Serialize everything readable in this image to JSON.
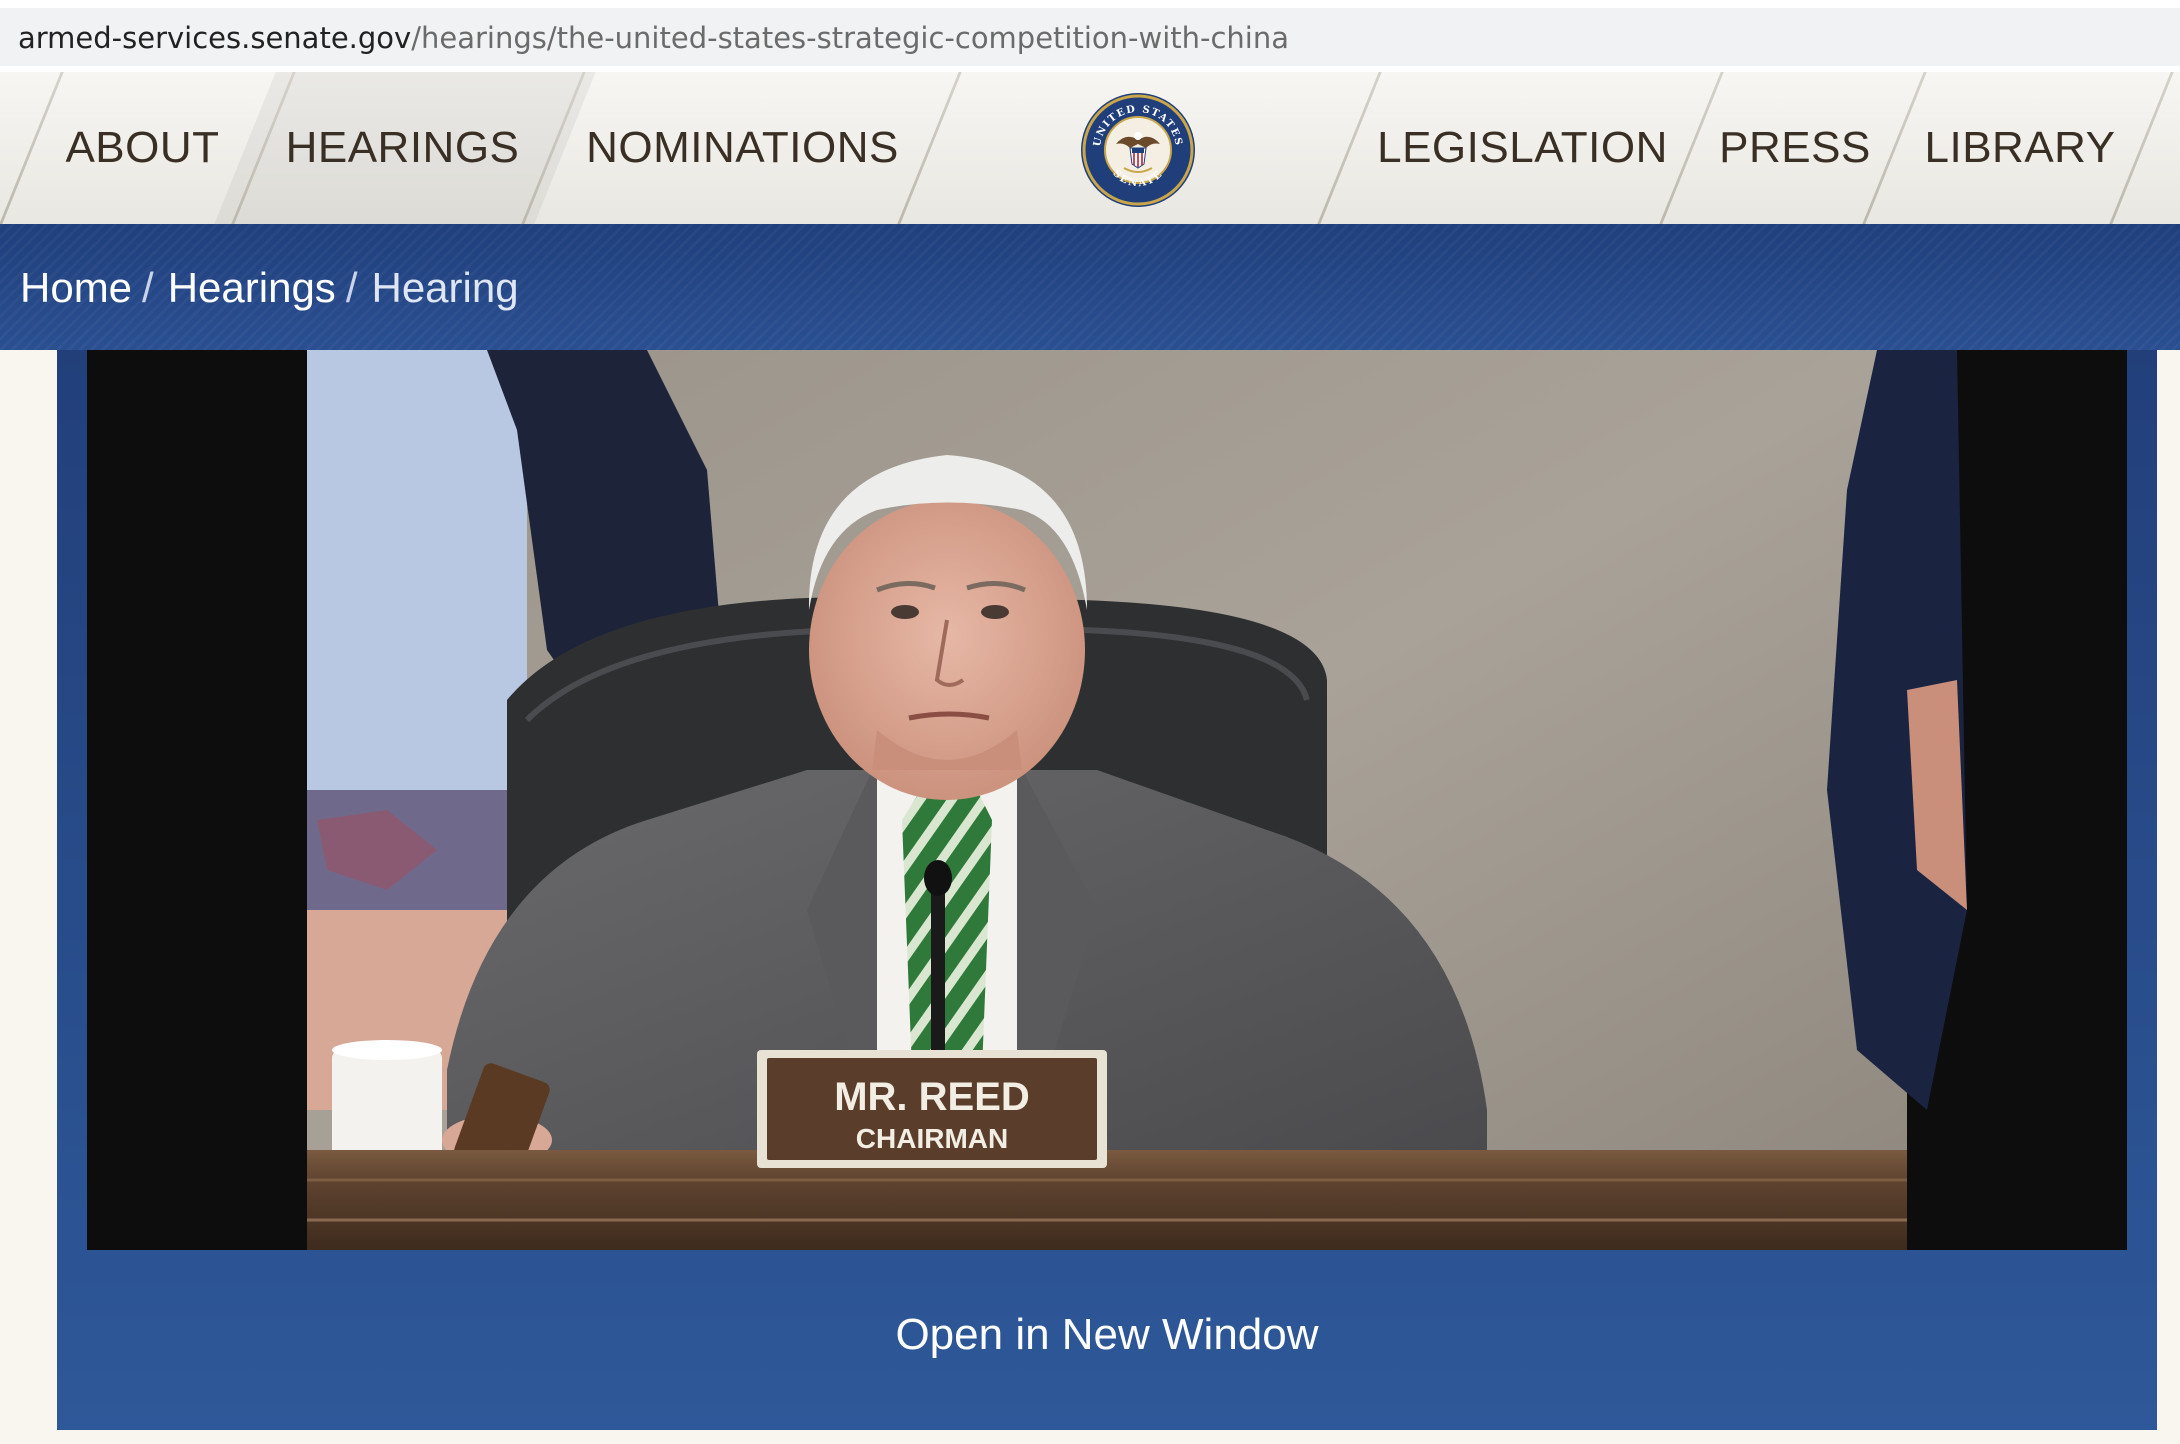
{
  "browser": {
    "url_domain": "armed-services.senate.gov",
    "url_path": "/hearings/the-united-states-strategic-competition-with-china"
  },
  "nav": {
    "items": [
      {
        "label": "ABOUT"
      },
      {
        "label": "HEARINGS"
      },
      {
        "label": "NOMINATIONS"
      },
      {
        "label": "LEGISLATION"
      },
      {
        "label": "PRESS"
      },
      {
        "label": "LIBRARY"
      }
    ],
    "active": "HEARINGS",
    "seal": {
      "top_text": "UNITED STATES",
      "bottom_text": "SENATE"
    }
  },
  "breadcrumb": {
    "home": "Home",
    "hearings": "Hearings",
    "current": "Hearing",
    "separator": "/"
  },
  "video": {
    "nameplate_name": "MR. REED",
    "nameplate_title": "CHAIRMAN"
  },
  "open_new_window": "Open in New Window",
  "colors": {
    "nav_text": "#3a2f24",
    "crumb_bar": "#1f3f7c",
    "panel": "#2a4f91",
    "page_bg": "#f8f6ee"
  }
}
